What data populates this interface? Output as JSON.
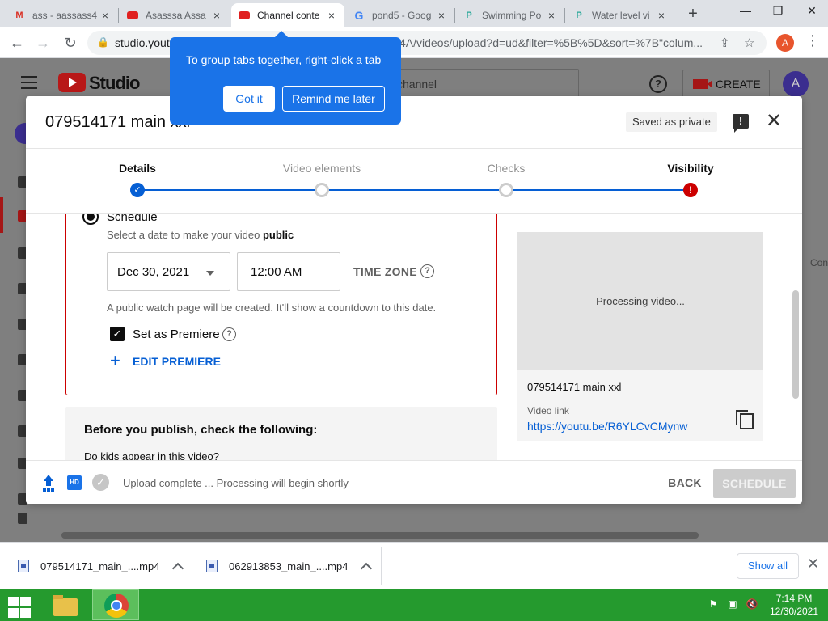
{
  "browser": {
    "tabs": [
      {
        "title": "ass - aassass4",
        "icon": "gmail-icon"
      },
      {
        "title": "Asasssa Assa",
        "icon": "youtube-icon"
      },
      {
        "title": "Channel conte",
        "icon": "youtube-icon",
        "active": true
      },
      {
        "title": "pond5 - Goog",
        "icon": "google-icon"
      },
      {
        "title": "Swimming Po",
        "icon": "pond5-icon"
      },
      {
        "title": "Water level vi",
        "icon": "pond5-icon"
      }
    ],
    "url_host": "studio.yout",
    "url_rest": "4A/videos/upload?d=ud&filter=%5B%5D&sort=%7B\"colum...",
    "profile_initial": "A"
  },
  "tooltip": {
    "text": "To group tabs together, right-click a tab",
    "got_it": "Got it",
    "remind": "Remind me later"
  },
  "studio": {
    "logo_text": "Studio",
    "search_placeholder": "channel",
    "help_glyph": "?",
    "create_label": "CREATE",
    "avatar_initial": "A",
    "ghost_text": "Con"
  },
  "dialog": {
    "title": "079514171 main xxl",
    "saved_badge": "Saved as private",
    "steps": [
      {
        "label": "Details",
        "state": "done"
      },
      {
        "label": "Video elements",
        "state": "todo"
      },
      {
        "label": "Checks",
        "state": "todo"
      },
      {
        "label": "Visibility",
        "state": "error"
      }
    ],
    "schedule": {
      "title": "Schedule",
      "subtitle": "Select a date to make your video",
      "subtitle_bold": "public",
      "date": "Dec 30, 2021",
      "time": "12:00 AM",
      "timezone_label": "TIME ZONE",
      "note": "A public watch page will be created. It'll show a countdown to this date.",
      "premiere_label": "Set as Premiere",
      "premiere_checked": true,
      "edit_premiere": "EDIT PREMIERE"
    },
    "checklist": {
      "title": "Before you publish, check the following:",
      "question": "Do kids appear in this video?"
    },
    "preview": {
      "processing": "Processing video...",
      "filename": "079514171 main xxl",
      "link_label": "Video link",
      "link": "https://youtu.be/R6YLCvCMynw"
    },
    "footer": {
      "hd_text": "HD",
      "status": "Upload complete ... Processing will begin shortly",
      "back": "BACK",
      "schedule": "SCHEDULE"
    }
  },
  "downloads": {
    "items": [
      {
        "name": "079514171_main_....mp4"
      },
      {
        "name": "062913853_main_....mp4"
      }
    ],
    "show_all": "Show all"
  },
  "taskbar": {
    "time": "7:14 PM",
    "date": "12/30/2021"
  },
  "colors": {
    "accent_blue": "#065fd4",
    "error_red": "#cc0000",
    "tooltip_blue": "#1a73e8",
    "taskbar_green": "#259a2e"
  }
}
